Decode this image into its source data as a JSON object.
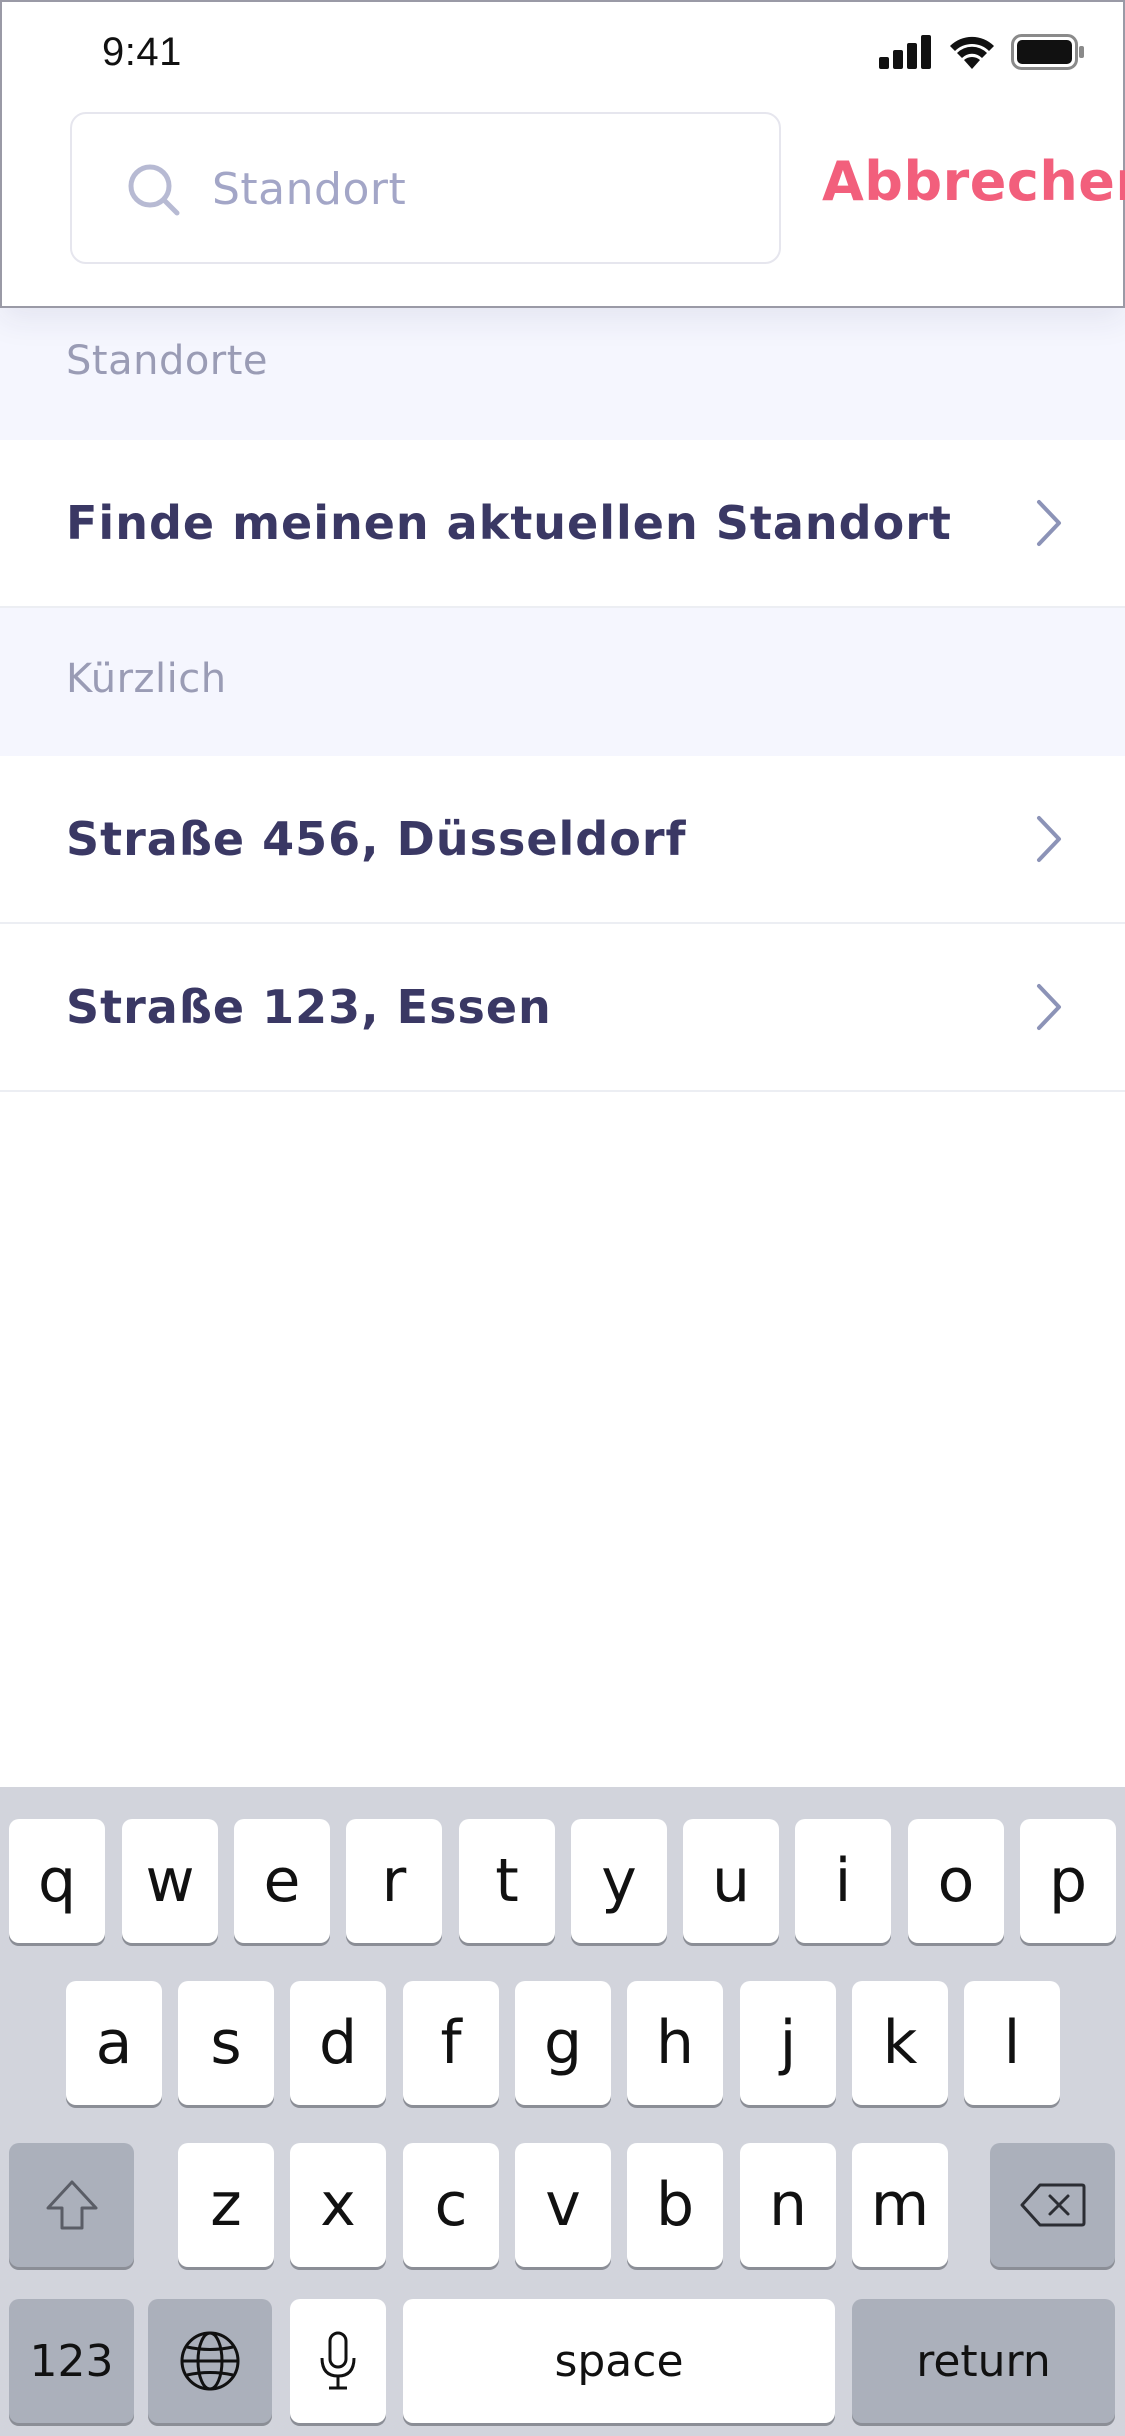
{
  "status": {
    "time": "9:41",
    "icons": [
      "cellular-signal-icon",
      "wifi-icon",
      "battery-icon"
    ]
  },
  "search": {
    "placeholder": "Standort",
    "cancel_label": "Abbrechen"
  },
  "sections": {
    "locations_title": "Standorte",
    "current_location_label": "Finde meinen aktuellen Standort",
    "recent_title": "Kürzlich",
    "recent_items": [
      "Straße 456, Düsseldorf",
      "Straße 123, Essen"
    ]
  },
  "keyboard": {
    "row1": [
      "q",
      "w",
      "e",
      "r",
      "t",
      "y",
      "u",
      "i",
      "o",
      "p"
    ],
    "row2": [
      "a",
      "s",
      "d",
      "f",
      "g",
      "h",
      "j",
      "k",
      "l"
    ],
    "row3": [
      "z",
      "x",
      "c",
      "v",
      "b",
      "n",
      "m"
    ],
    "numbers_label": "123",
    "space_label": "space",
    "return_label": "return",
    "icons": [
      "shift-icon",
      "backspace-icon",
      "globe-icon",
      "microphone-icon"
    ]
  },
  "colors": {
    "accent": "#f25f7c",
    "text_primary": "#3a3864",
    "section_background": "#f5f6fe",
    "keyboard_background": "#d2d4dc"
  }
}
